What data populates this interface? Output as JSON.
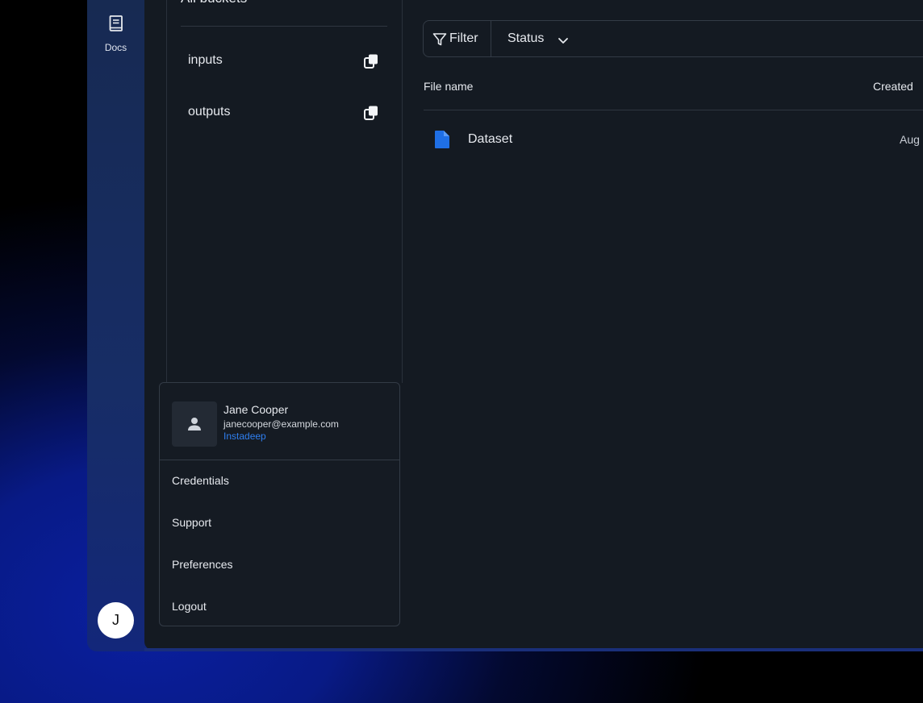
{
  "sidebar": {
    "docs_label": "Docs",
    "avatar_initial": "J"
  },
  "buckets": {
    "heading": "All buckets",
    "items": [
      {
        "name": "inputs"
      },
      {
        "name": "outputs"
      }
    ]
  },
  "user_menu": {
    "name": "Jane Cooper",
    "email": "janecooper@example.com",
    "organization": "Instadeep",
    "items": [
      "Credentials",
      "Support",
      "Preferences",
      "Logout"
    ]
  },
  "toolbar": {
    "filter_label": "Filter",
    "status_label": "Status"
  },
  "table": {
    "columns": [
      "File name",
      "Created"
    ],
    "rows": [
      {
        "name": "Dataset",
        "created": "Aug"
      }
    ]
  },
  "colors": {
    "accent": "#2f7ff0",
    "file_icon": "#1f6fe5",
    "panel": "#141a22",
    "rail": "#172a52"
  }
}
